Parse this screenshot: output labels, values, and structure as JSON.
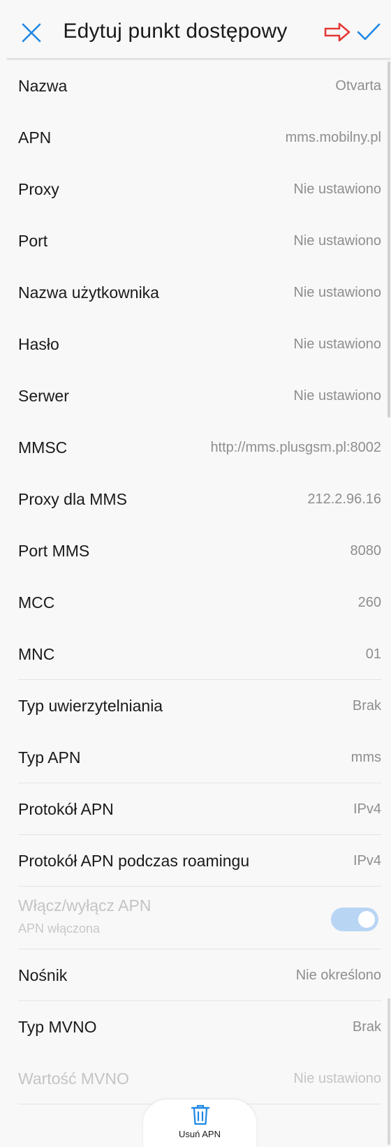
{
  "header": {
    "title": "Edytuj punkt dostępowy",
    "close_icon": "close-icon",
    "confirm_icon": "check-icon",
    "annotation_arrow_icon": "arrow-right-icon",
    "accent_color": "#1e88e5",
    "arrow_color": "#e53935"
  },
  "fields": [
    {
      "label": "Nazwa",
      "value": "Otvarta"
    },
    {
      "label": "APN",
      "value": "mms.mobilny.pl"
    },
    {
      "label": "Proxy",
      "value": "Nie ustawiono"
    },
    {
      "label": "Port",
      "value": "Nie ustawiono"
    },
    {
      "label": "Nazwa użytkownika",
      "value": "Nie ustawiono"
    },
    {
      "label": "Hasło",
      "value": "Nie ustawiono"
    },
    {
      "label": "Serwer",
      "value": "Nie ustawiono"
    },
    {
      "label": "MMSC",
      "value": "http://mms.plusgsm.pl:8002"
    },
    {
      "label": "Proxy dla MMS",
      "value": "212.2.96.16"
    },
    {
      "label": "Port MMS",
      "value": "8080"
    },
    {
      "label": "MCC",
      "value": "260"
    },
    {
      "label": "MNC",
      "value": "01"
    },
    {
      "label": "Typ uwierzytelniania",
      "value": "Brak"
    },
    {
      "label": "Typ APN",
      "value": "mms"
    },
    {
      "label": "Protokół APN",
      "value": "IPv4"
    },
    {
      "label": "Protokół APN podczas roamingu",
      "value": "IPv4"
    },
    {
      "label": "Nośnik",
      "value": "Nie określono"
    },
    {
      "label": "Typ MVNO",
      "value": "Brak"
    },
    {
      "label": "Wartość MVNO",
      "value": "Nie ustawiono"
    }
  ],
  "apn_toggle": {
    "label": "Włącz/wyłącz APN",
    "sublabel": "APN włączona",
    "state": "on",
    "enabled": false,
    "color": "#b9d5f4"
  },
  "delete_button": {
    "label": "Usuń APN",
    "icon": "trash-icon"
  }
}
